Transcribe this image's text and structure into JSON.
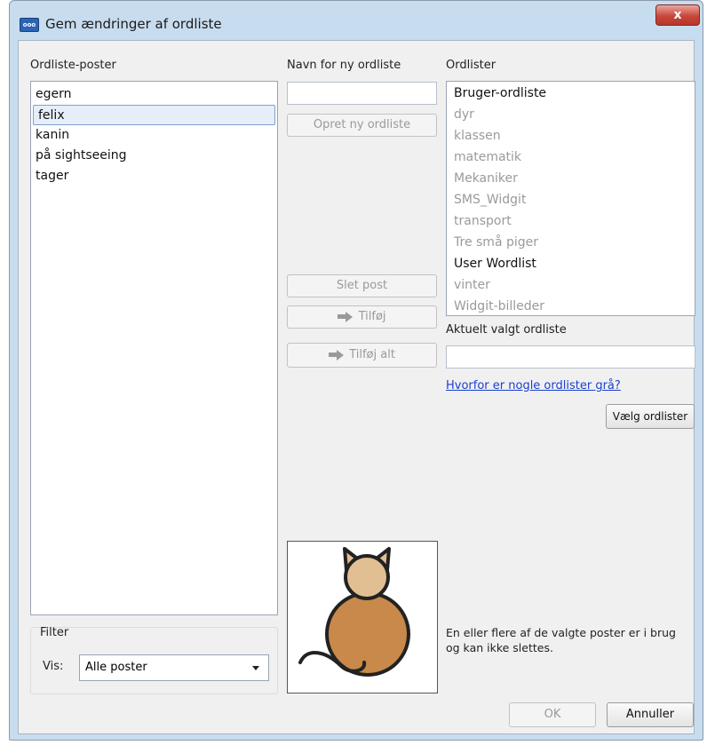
{
  "window": {
    "title": "Gem ændringer af ordliste",
    "icon": "app-icon",
    "close_label": "x"
  },
  "entries": {
    "label": "Ordliste-poster",
    "items": [
      {
        "text": "egern",
        "selected": false
      },
      {
        "text": "felix",
        "selected": true
      },
      {
        "text": "kanin",
        "selected": false
      },
      {
        "text": "på sightseeing",
        "selected": false
      },
      {
        "text": "tager",
        "selected": false
      }
    ]
  },
  "filter": {
    "label": "Filter",
    "show_label": "Vis:",
    "selected": "Alle poster"
  },
  "new_list": {
    "label": "Navn for ny ordliste",
    "value": "",
    "create_button": "Opret ny ordliste"
  },
  "actions": {
    "delete": "Slet post",
    "add": "Tilføj",
    "add_all": "Tilføj alt"
  },
  "wordlists": {
    "label": "Ordlister",
    "items": [
      {
        "text": "Bruger-ordliste",
        "enabled": true
      },
      {
        "text": "dyr",
        "enabled": false
      },
      {
        "text": "klassen",
        "enabled": false
      },
      {
        "text": "matematik",
        "enabled": false
      },
      {
        "text": "Mekaniker",
        "enabled": false
      },
      {
        "text": "SMS_Widgit",
        "enabled": false
      },
      {
        "text": "transport",
        "enabled": false
      },
      {
        "text": "Tre små piger",
        "enabled": false
      },
      {
        "text": "User Wordlist",
        "enabled": true
      },
      {
        "text": "vinter",
        "enabled": false
      },
      {
        "text": "Widgit-billeder",
        "enabled": false
      }
    ]
  },
  "current": {
    "label": "Aktuelt valgt ordliste",
    "value": ""
  },
  "why_gray_link": "Hvorfor er nogle ordlister grå?",
  "choose_button": "Vælg ordlister",
  "preview": {
    "symbol": "cat-symbol"
  },
  "message": "En eller flere af de valgte poster er i brug og kan ikke slettes.",
  "footer": {
    "ok": "OK",
    "cancel": "Annuller"
  },
  "colors": {
    "title_bar": "#c8dcef",
    "link": "#1a3fcf",
    "cat_body": "#c8894a",
    "cat_head": "#e2bf93",
    "close_button": "#c8473a"
  }
}
